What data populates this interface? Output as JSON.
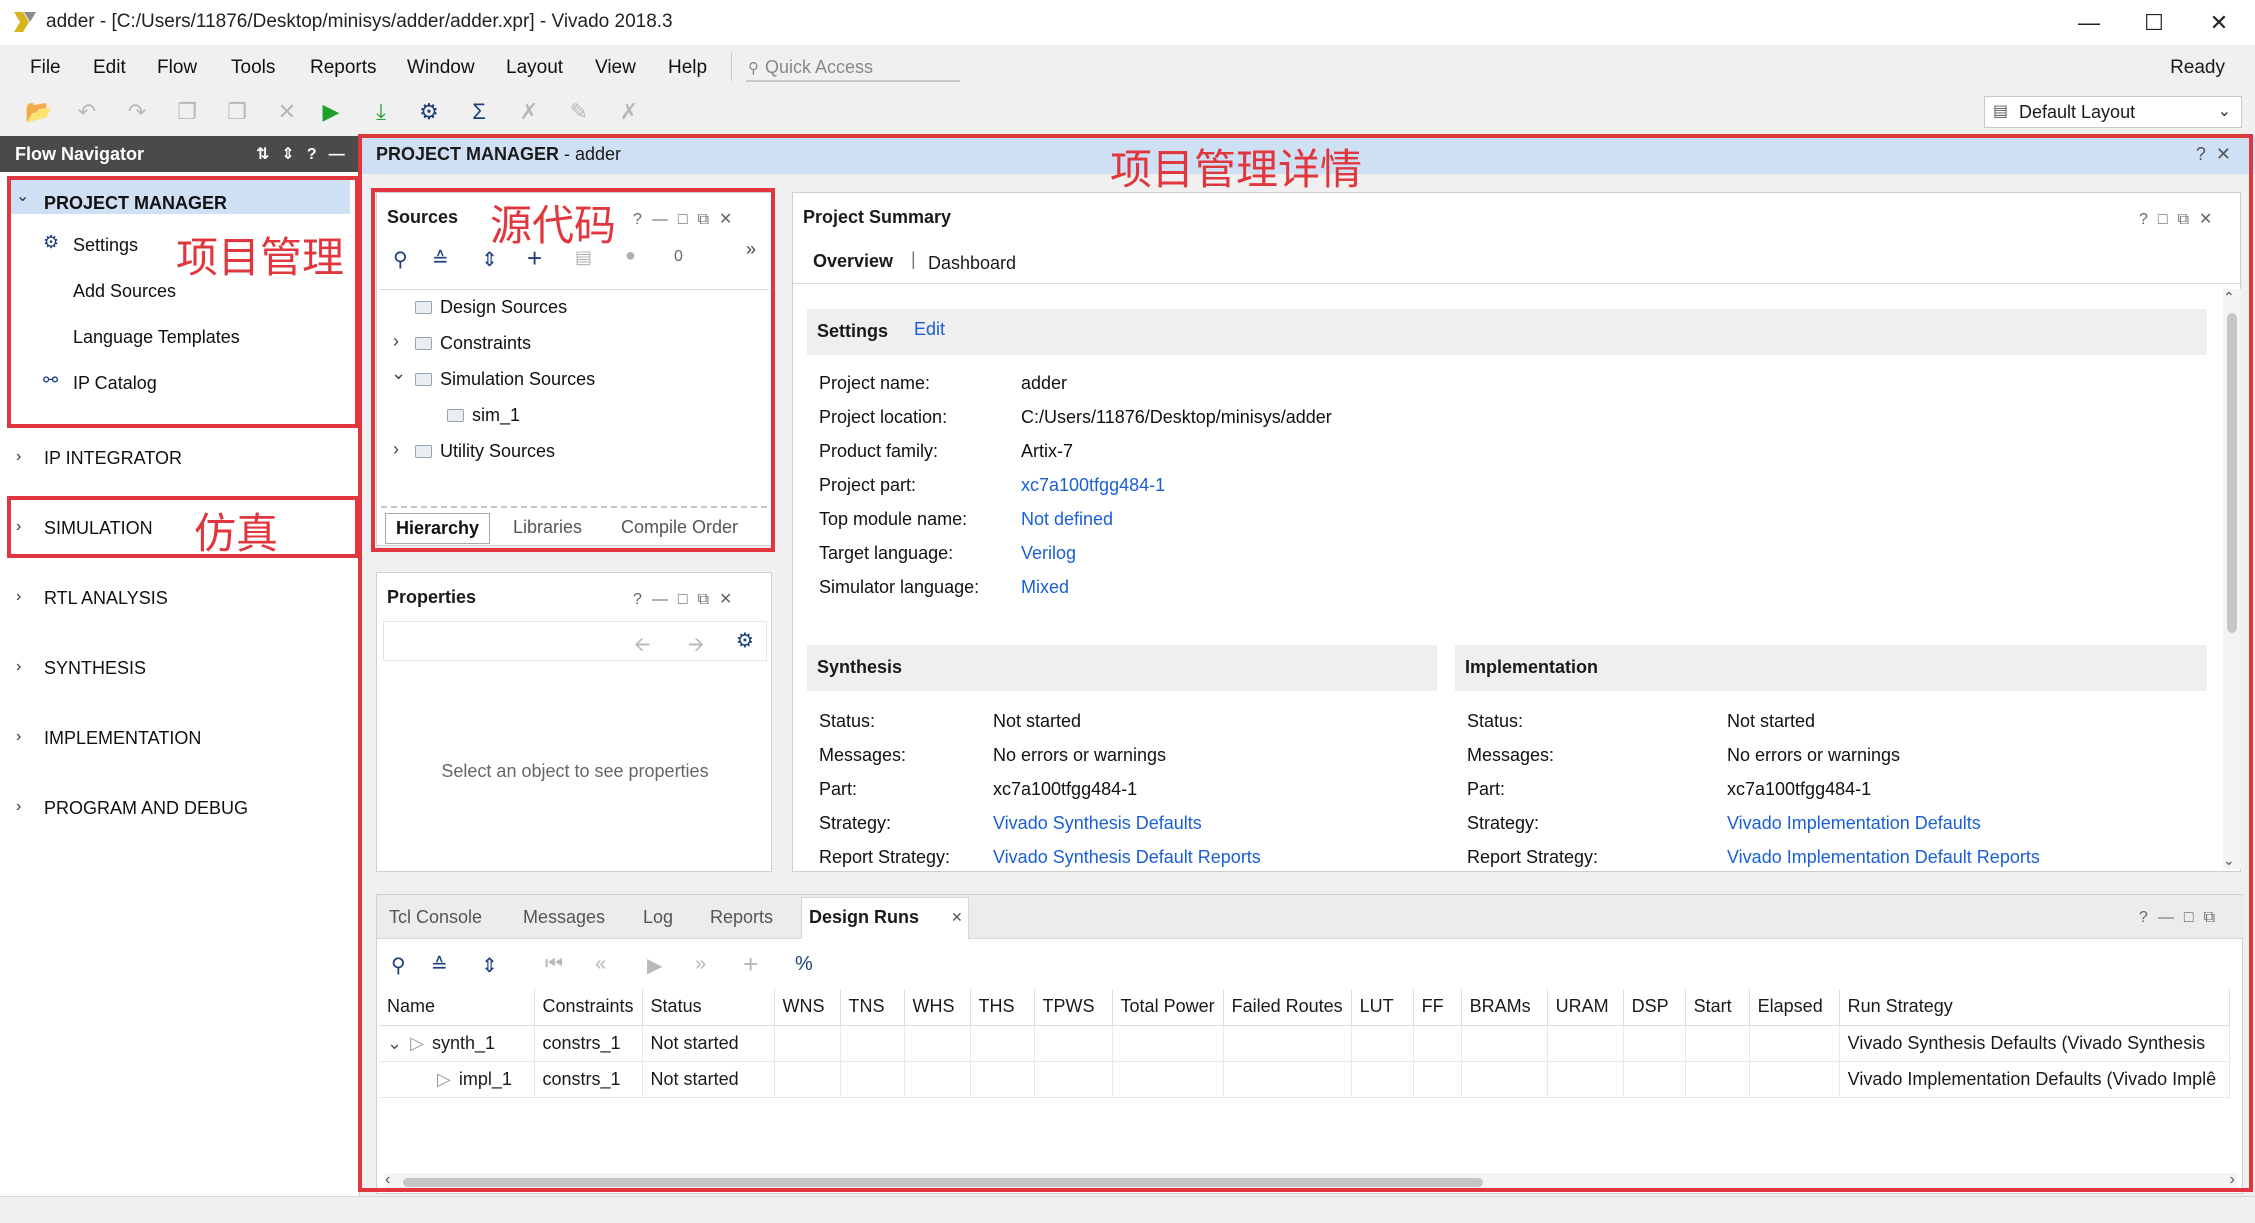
{
  "window": {
    "title": "adder - [C:/Users/11876/Desktop/minisys/adder/adder.xpr] - Vivado 2018.3",
    "minimize": "—",
    "maximize": "☐",
    "close": "✕"
  },
  "menu": [
    "File",
    "Edit",
    "Flow",
    "Tools",
    "Reports",
    "Window",
    "Layout",
    "View",
    "Help"
  ],
  "quick_access": "Quick Access",
  "status": "Ready",
  "layout_selector": "Default Layout",
  "flow_navigator": {
    "title": "Flow Navigator",
    "sections": {
      "project_manager": "PROJECT MANAGER",
      "settings": "Settings",
      "add_sources": "Add Sources",
      "language_templates": "Language Templates",
      "ip_catalog": "IP Catalog",
      "ip_integrator": "IP INTEGRATOR",
      "simulation": "SIMULATION",
      "rtl_analysis": "RTL ANALYSIS",
      "synthesis": "SYNTHESIS",
      "implementation": "IMPLEMENTATION",
      "program_debug": "PROGRAM AND DEBUG"
    }
  },
  "main_header": {
    "label": "PROJECT MANAGER",
    "suffix": " - adder"
  },
  "sources": {
    "title": "Sources",
    "count": "0",
    "tree": {
      "design_sources": "Design Sources",
      "constraints": "Constraints",
      "simulation_sources": "Simulation Sources",
      "sim_1": "sim_1",
      "utility_sources": "Utility Sources"
    },
    "tabs": {
      "hierarchy": "Hierarchy",
      "libraries": "Libraries",
      "compile_order": "Compile Order"
    }
  },
  "properties": {
    "title": "Properties",
    "empty": "Select an object to see properties"
  },
  "summary": {
    "title": "Project Summary",
    "tab_overview": "Overview",
    "tab_separator": "|",
    "tab_dashboard": "Dashboard",
    "settings_title": "Settings",
    "settings_edit": "Edit",
    "settings": {
      "project_name_k": "Project name:",
      "project_name_v": "adder",
      "project_location_k": "Project location:",
      "project_location_v": "C:/Users/11876/Desktop/minisys/adder",
      "product_family_k": "Product family:",
      "product_family_v": "Artix-7",
      "project_part_k": "Project part:",
      "project_part_v": "xc7a100tfgg484-1",
      "top_module_k": "Top module name:",
      "top_module_v": "Not defined",
      "target_language_k": "Target language:",
      "target_language_v": "Verilog",
      "sim_language_k": "Simulator language:",
      "sim_language_v": "Mixed"
    },
    "synthesis": {
      "title": "Synthesis",
      "status_k": "Status:",
      "status_v": "Not started",
      "messages_k": "Messages:",
      "messages_v": "No errors or warnings",
      "part_k": "Part:",
      "part_v": "xc7a100tfgg484-1",
      "strategy_k": "Strategy:",
      "strategy_v": "Vivado Synthesis Defaults",
      "report_k": "Report Strategy:",
      "report_v": "Vivado Synthesis Default Reports"
    },
    "implementation": {
      "title": "Implementation",
      "status_k": "Status:",
      "status_v": "Not started",
      "messages_k": "Messages:",
      "messages_v": "No errors or warnings",
      "part_k": "Part:",
      "part_v": "xc7a100tfgg484-1",
      "strategy_k": "Strategy:",
      "strategy_v": "Vivado Implementation Defaults",
      "report_k": "Report Strategy:",
      "report_v": "Vivado Implementation Default Reports"
    }
  },
  "bottom": {
    "tabs": {
      "tcl": "Tcl Console",
      "messages": "Messages",
      "log": "Log",
      "reports": "Reports",
      "design_runs": "Design Runs"
    },
    "columns": [
      "Name",
      "Constraints",
      "Status",
      "WNS",
      "TNS",
      "WHS",
      "THS",
      "TPWS",
      "Total Power",
      "Failed Routes",
      "LUT",
      "FF",
      "BRAMs",
      "URAM",
      "DSP",
      "Start",
      "Elapsed",
      "Run Strategy"
    ],
    "rows": [
      {
        "name": "synth_1",
        "constraints": "constrs_1",
        "status": "Not started",
        "strategy": "Vivado Synthesis Defaults (Vivado Synthesis"
      },
      {
        "name": "impl_1",
        "constraints": "constrs_1",
        "status": "Not started",
        "strategy": "Vivado Implementation Defaults (Vivado Implê"
      }
    ]
  },
  "annotations": {
    "project_mgmt": "项目管理",
    "simulation": "仿真",
    "source_code": "源代码",
    "project_details": "项目管理详情"
  },
  "colors": {
    "annotation": "#e0373e",
    "header_blue": "#cfe0f5",
    "link": "#1a5fd6",
    "nav_header": "#4a4a4a"
  }
}
